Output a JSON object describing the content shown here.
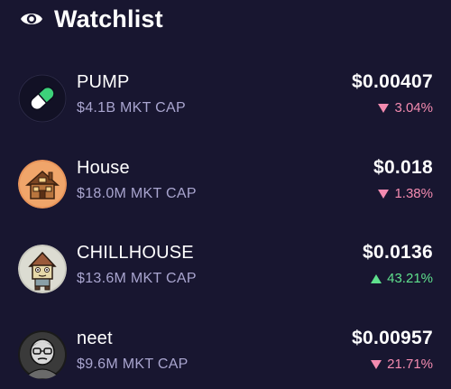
{
  "header": {
    "title": "Watchlist",
    "icon": "eye-icon"
  },
  "colors": {
    "background": "#181630",
    "down": "#f48bb0",
    "up": "#5fe08d",
    "muted": "#a9a5cf"
  },
  "tokens": [
    {
      "name": "PUMP",
      "market_cap": "$4.1B MKT CAP",
      "price": "$0.00407",
      "change": "3.04%",
      "direction": "down",
      "icon": "pill-icon"
    },
    {
      "name": "House",
      "market_cap": "$18.0M MKT CAP",
      "price": "$0.018",
      "change": "1.38%",
      "direction": "down",
      "icon": "house-icon"
    },
    {
      "name": "CHILLHOUSE",
      "market_cap": "$13.6M MKT CAP",
      "price": "$0.0136",
      "change": "43.21%",
      "direction": "up",
      "icon": "chillhouse-icon"
    },
    {
      "name": "neet",
      "market_cap": "$9.6M MKT CAP",
      "price": "$0.00957",
      "change": "21.71%",
      "direction": "down",
      "icon": "neet-icon"
    }
  ]
}
